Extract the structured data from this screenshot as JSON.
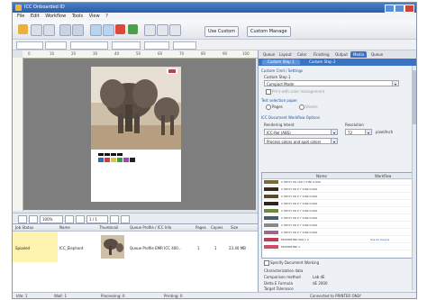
{
  "window": {
    "title": "ICC Onboarded ID"
  },
  "menu": [
    "File",
    "Edit",
    "Workflow",
    "Tools",
    "View",
    "?"
  ],
  "toolbar": {
    "color_button": "Use Custom",
    "profile_button": "Custom Manage"
  },
  "ruler": {
    "ticks": [
      "0",
      "10",
      "20",
      "30",
      "40",
      "50",
      "60",
      "70",
      "80",
      "90",
      "100"
    ]
  },
  "zoom": {
    "value": "100%",
    "page": "1 / 1"
  },
  "job_table": {
    "headers": [
      "Job Status",
      "Name",
      "Thumbnail",
      "Queue Profile / ICC Info",
      "Pages",
      "Copies",
      "Size"
    ],
    "rows": [
      {
        "status": "Spooled",
        "name": "ICC_Elephant",
        "info": "Queue Profile EMR ICC 400...",
        "pages": "1",
        "copies": "1",
        "size": "23.40 MB"
      }
    ]
  },
  "panel": {
    "tabs": [
      "Queue",
      "Layout",
      "Color",
      "Finishing",
      "Output",
      "Media",
      "Queue"
    ],
    "active_tab": "Media",
    "subtabs": [
      "Custom Step 1",
      "Custom Step 2"
    ],
    "section_custom": "Custom Cmd / Settings",
    "custom_label": "Custom Step 1",
    "custom_dropdown": "Compact Mode",
    "check_1": "Print with color management",
    "section_select": "Test selection paper",
    "radio_1": "Pages",
    "radio_2": "Sheets",
    "section_icc": "ICC Document Workflow Options",
    "rendering_label": "Rendering Intent",
    "rendering_value": "ICC-Rel (ABS)",
    "resolution_label": "Resolution",
    "resolution_value": "72",
    "resolution_unit": "pixel/Inch",
    "process_dropdown": "Process colors and spot colors",
    "grid_headers": [
      "",
      "Name",
      "Workflow"
    ],
    "grid_rows": [
      {
        "color": "#7a6a3a",
        "name": "C 0M 0Y 0K 100 Y 0 BK 0.000",
        "extra": ""
      },
      {
        "color": "#3a2a1a",
        "name": "C 0M 0Y 0K 0 Y 0 BK 0.000",
        "extra": ""
      },
      {
        "color": "#5a4a2a",
        "name": "C 0M 0Y 0K 0 Y 0 BK 0.000",
        "extra": ""
      },
      {
        "color": "#2a2420",
        "name": "C 0M 0Y 0K 0 Y 0 BK 0.000",
        "extra": ""
      },
      {
        "color": "#6a8a3a",
        "name": "C 0M 0Y 0K 0 Y 0 BK 0.000",
        "extra": ""
      },
      {
        "color": "#4a5a6a",
        "name": "C 0M 0Y 0K 0 Y 0 BK 0.000",
        "extra": ""
      },
      {
        "color": "#8a8a8a",
        "name": "C 0M 0Y 0K 0 Y 0 BK 0.000",
        "extra": ""
      },
      {
        "color": "#9a6a8a",
        "name": "C 0M 0Y 0K 0 Y 0 BK 0.000",
        "extra": ""
      },
      {
        "color": "#c03a5a",
        "name": "MASTER BRI 000 1 2",
        "extra": "Use as Source"
      },
      {
        "color": "#d04a6a",
        "name": "MASTER BRI 1",
        "extra": ""
      }
    ],
    "check_2": "Specify Document Working",
    "char_label": "Characterization data",
    "comp_label": "Comparison method",
    "comp_value": "Lab dE",
    "delta_label": "Delta E Formula",
    "delta_value": "dE 2000",
    "target_label": "Target Tolerance"
  },
  "status": [
    "Idle: 1",
    "Wait: 1",
    "Processing: 0",
    "Printing: 0",
    "Connected to PRINTER ONLY"
  ],
  "colors": {
    "accent": "#3a72c4",
    "title_bar": "#2a5ea8"
  }
}
